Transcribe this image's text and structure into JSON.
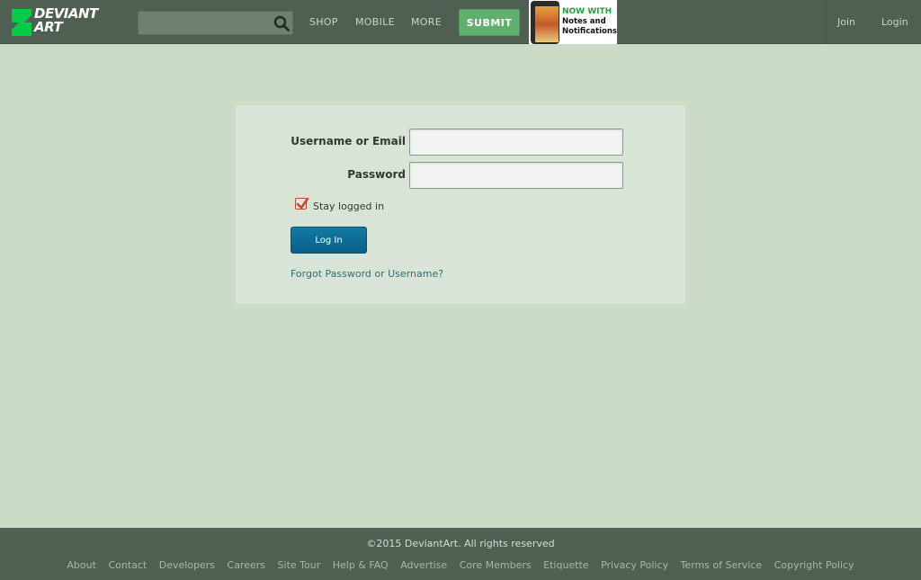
{
  "header": {
    "logo_line1": "DEVIANT",
    "logo_line2": "ART",
    "search": {
      "value": "",
      "placeholder": ""
    },
    "nav": [
      "SHOP",
      "MOBILE",
      "MORE"
    ],
    "submit_label": "SUBMIT",
    "promo": {
      "line1": "NOW WITH",
      "line2": "Notes and",
      "line3": "Notifications"
    },
    "join_label": "Join",
    "login_label": "Login"
  },
  "login": {
    "username_label": "Username or Email",
    "username_value": "",
    "password_label": "Password",
    "password_value": "",
    "stay_logged_in_label": "Stay logged in",
    "stay_logged_in_checked": true,
    "login_button": "Log In",
    "forgot_link": "Forgot Password or Username?"
  },
  "footer": {
    "copyright": "©2015 DeviantArt. All rights reserved",
    "links": [
      "About",
      "Contact",
      "Developers",
      "Careers",
      "Site Tour",
      "Help & FAQ",
      "Advertise",
      "Core Members",
      "Etiquette",
      "Privacy Policy",
      "Terms of Service",
      "Copyright Policy"
    ]
  },
  "colors": {
    "background": "#cbdbc6",
    "header": "#4f5f52",
    "submit": "#5faf6e",
    "login_button": "#0b6089",
    "link": "#2d6f7c"
  }
}
